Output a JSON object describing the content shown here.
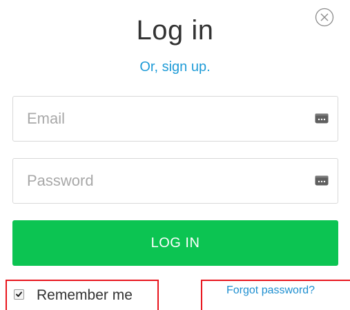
{
  "modal": {
    "title": "Log in",
    "signup_link": "Or, sign up.",
    "close_icon": "close-circle-icon"
  },
  "email": {
    "placeholder": "Email",
    "value": "",
    "icon": "password-manager-icon"
  },
  "password": {
    "placeholder": "Password",
    "value": "",
    "icon": "password-manager-icon"
  },
  "login_button": {
    "label": "LOG IN"
  },
  "remember": {
    "label": "Remember me",
    "checked": true
  },
  "forgot": {
    "label": "Forgot password?"
  },
  "colors": {
    "accent_green": "#0cc452",
    "link_blue": "#1e9bd7",
    "highlight_red": "#e8141c"
  }
}
